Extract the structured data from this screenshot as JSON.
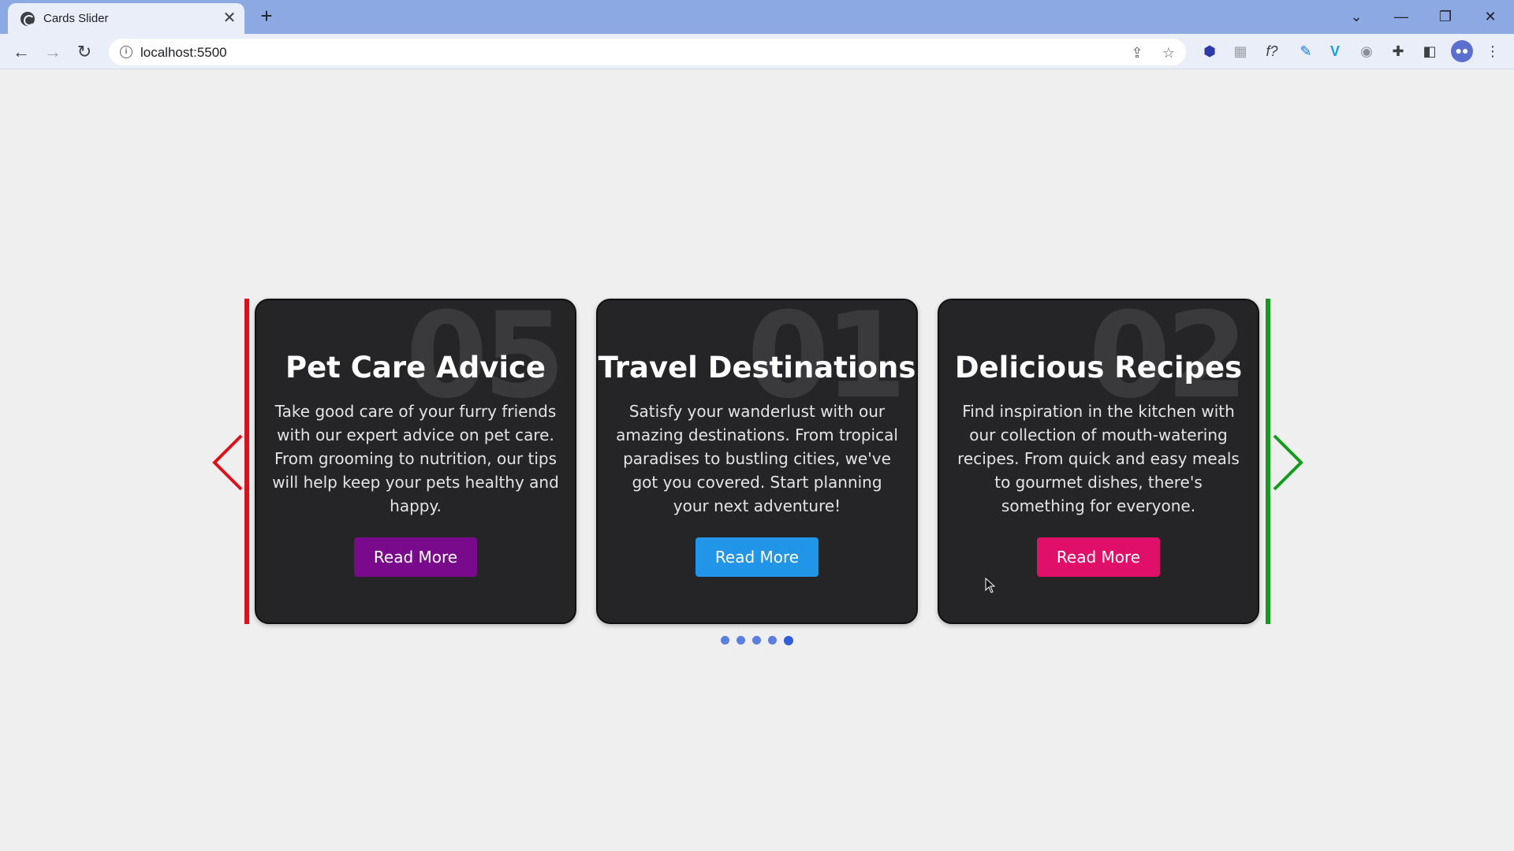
{
  "browser": {
    "tab_title": "Cards Slider",
    "tab_close": "✕",
    "new_tab": "+",
    "url": "localhost:5500",
    "minimize": "—",
    "restore": "❐",
    "close": "✕",
    "dropdown": "⌄"
  },
  "slider": {
    "left_bar_color": "#e0101a",
    "right_bar_color": "#129c1a",
    "cards": [
      {
        "number": "05",
        "title": "Pet Care Advice",
        "text": "Take good care of your furry friends with our expert advice on pet care. From grooming to nutrition, our tips will help keep your pets healthy and happy.",
        "button": "Read More",
        "button_color": "#7a0a8c"
      },
      {
        "number": "01",
        "title": "Travel Destinations",
        "text": "Satisfy your wanderlust with our amazing destinations. From tropical paradises to bustling cities, we've got you covered. Start planning your next adventure!",
        "button": "Read More",
        "button_color": "#2196e8"
      },
      {
        "number": "02",
        "title": "Delicious Recipes",
        "text": "Find inspiration in the kitchen with our collection of mouth-watering recipes. From quick and easy meals to gourmet dishes, there's something for everyone.",
        "button": "Read More",
        "button_color": "#e0106a"
      }
    ],
    "pagination": {
      "count": 5,
      "active": 5
    }
  }
}
